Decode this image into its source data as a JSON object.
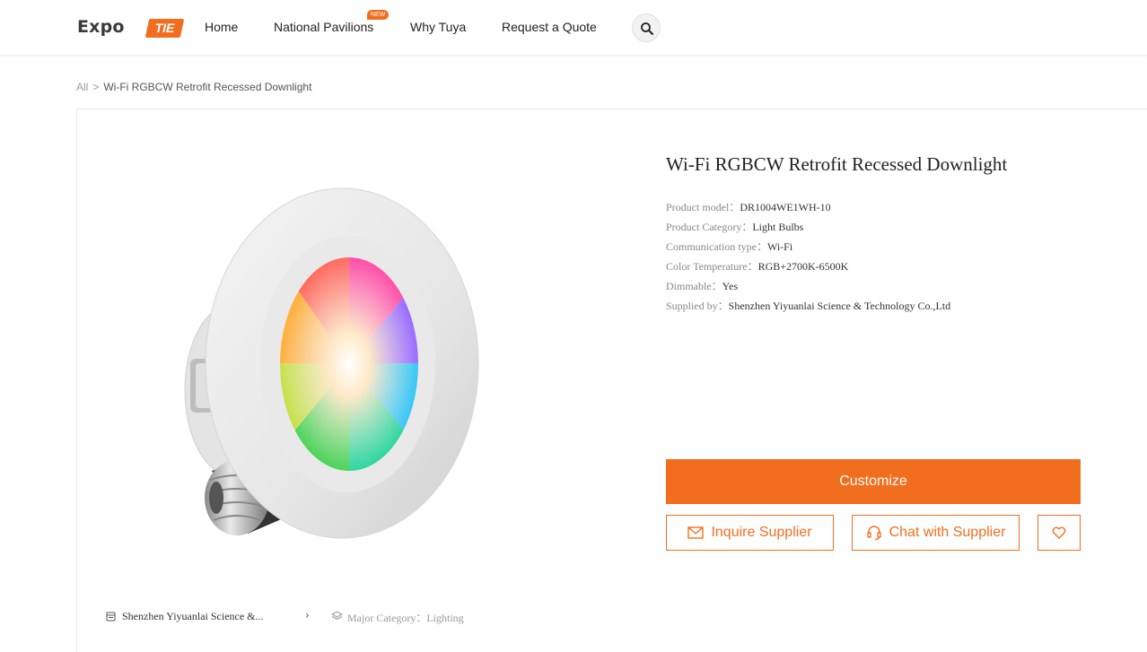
{
  "header": {
    "logo_text": "Expo",
    "logo_badge": "TIE",
    "nav": [
      {
        "label": "Home"
      },
      {
        "label": "National Pavilions",
        "badge": "NEW"
      },
      {
        "label": "Why Tuya"
      },
      {
        "label": "Request a Quote"
      }
    ],
    "search_icon": "search-icon"
  },
  "breadcrumb": {
    "root": "All",
    "separator": ">",
    "current": "Wi-Fi RGBCW Retrofit Recessed Downlight"
  },
  "product": {
    "title": "Wi-Fi RGBCW Retrofit Recessed Downlight",
    "specs": [
      {
        "label": "Product model：",
        "value": "DR1004WE1WH-10"
      },
      {
        "label": "Product Category：",
        "value": "Light Bulbs"
      },
      {
        "label": "Communication type：",
        "value": "Wi-Fi"
      },
      {
        "label": "Color Temperature：",
        "value": "RGB+2700K-6500K"
      },
      {
        "label": "Dimmable：",
        "value": "Yes"
      },
      {
        "label": "Supplied by：",
        "value": "Shenzhen Yiyuanlai Science & Technology Co.,Ltd"
      }
    ]
  },
  "actions": {
    "customize": "Customize",
    "inquire": "Inquire Supplier",
    "chat": "Chat with Supplier"
  },
  "supplier_bar": {
    "name": "Shenzhen Yiyuanlai Science &...",
    "category_label": "Major Category：",
    "category_value": "Lighting"
  },
  "colors": {
    "accent": "#f26e1f"
  }
}
